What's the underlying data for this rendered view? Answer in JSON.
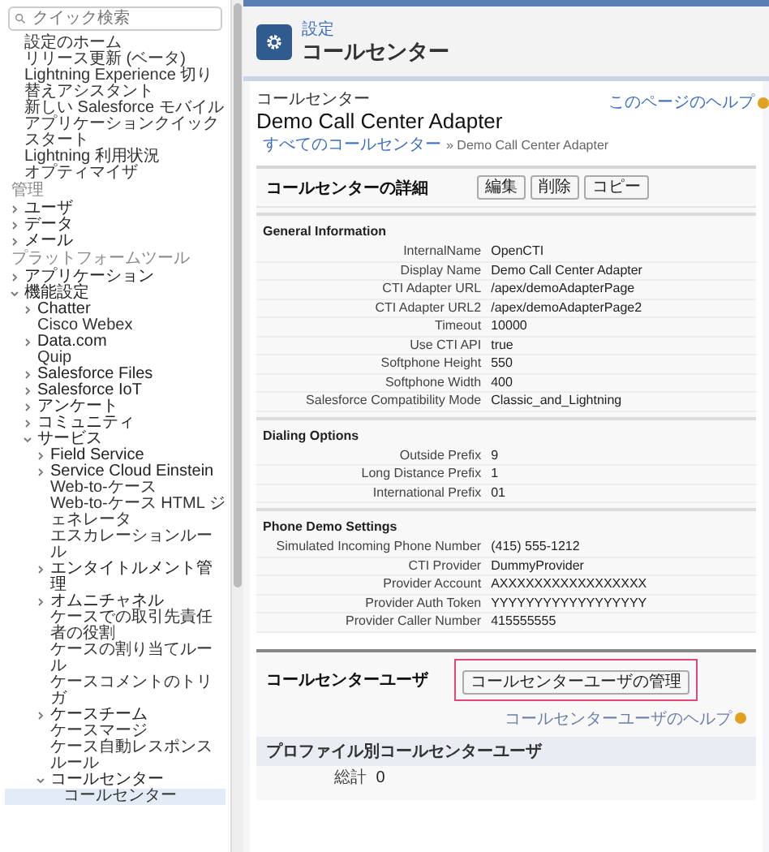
{
  "sidebar": {
    "search": {
      "placeholder": "クイック検索"
    },
    "items": [
      {
        "label": "設定のホーム",
        "kind": "link",
        "selected": false
      },
      {
        "label": "リリース更新 (ベータ)",
        "kind": "link",
        "selected": false
      },
      {
        "label": "Lightning Experience 切り替えアシスタント",
        "kind": "link",
        "selected": false
      },
      {
        "label": "新しい Salesforce モバイルアプリケーションクイックスタート",
        "kind": "link",
        "selected": false
      },
      {
        "label": "Lightning 利用状況",
        "kind": "link",
        "selected": false
      },
      {
        "label": "オプティマイザ",
        "kind": "link",
        "selected": false
      },
      {
        "label": "管理",
        "kind": "heading"
      },
      {
        "label": "ユーザ",
        "kind": "node",
        "expanded": false,
        "selected": false
      },
      {
        "label": "データ",
        "kind": "node",
        "expanded": false,
        "selected": false
      },
      {
        "label": "メール",
        "kind": "node",
        "expanded": false,
        "selected": false
      },
      {
        "label": "プラットフォームツール",
        "kind": "heading"
      },
      {
        "label": "アプリケーション",
        "kind": "node",
        "expanded": false,
        "selected": false
      },
      {
        "label": "機能設定",
        "kind": "node",
        "expanded": true,
        "selected": false,
        "children": [
          {
            "label": "Chatter",
            "kind": "node",
            "expanded": false,
            "selected": false
          },
          {
            "label": "Cisco Webex",
            "kind": "link",
            "selected": false
          },
          {
            "label": "Data.com",
            "kind": "node",
            "expanded": false,
            "selected": false
          },
          {
            "label": "Quip",
            "kind": "link",
            "selected": false
          },
          {
            "label": "Salesforce Files",
            "kind": "node",
            "expanded": false,
            "selected": false
          },
          {
            "label": "Salesforce IoT",
            "kind": "node",
            "expanded": false,
            "selected": false
          },
          {
            "label": "アンケート",
            "kind": "node",
            "expanded": false,
            "selected": false
          },
          {
            "label": "コミュニティ",
            "kind": "node",
            "expanded": false,
            "selected": false
          },
          {
            "label": "サービス",
            "kind": "node",
            "expanded": true,
            "selected": false,
            "children": [
              {
                "label": "Field Service",
                "kind": "node",
                "expanded": false,
                "selected": false
              },
              {
                "label": "Service Cloud Einstein",
                "kind": "node",
                "expanded": false,
                "selected": false
              },
              {
                "label": "Web-to-ケース",
                "kind": "link",
                "selected": false
              },
              {
                "label": "Web-to-ケース HTML ジェネレータ",
                "kind": "link",
                "selected": false
              },
              {
                "label": "エスカレーションルール",
                "kind": "link",
                "selected": false
              },
              {
                "label": "エンタイトルメント管理",
                "kind": "node",
                "expanded": false,
                "selected": false
              },
              {
                "label": "オムニチャネル",
                "kind": "node",
                "expanded": false,
                "selected": false
              },
              {
                "label": "ケースでの取引先責任者の役割",
                "kind": "link",
                "selected": false
              },
              {
                "label": "ケースの割り当てルール",
                "kind": "link",
                "selected": false
              },
              {
                "label": "ケースコメントのトリガ",
                "kind": "link",
                "selected": false
              },
              {
                "label": "ケースチーム",
                "kind": "node",
                "expanded": false,
                "selected": false
              },
              {
                "label": "ケースマージ",
                "kind": "link",
                "selected": false
              },
              {
                "label": "ケース自動レスポンスルール",
                "kind": "link",
                "selected": false
              },
              {
                "label": "コールセンター",
                "kind": "node",
                "expanded": true,
                "selected": false,
                "children": [
                  {
                    "label": "コールセンター",
                    "kind": "link",
                    "selected": true
                  }
                ]
              }
            ]
          }
        ]
      }
    ]
  },
  "header": {
    "breadcrumb": "設定",
    "title": "コールセンター"
  },
  "record": {
    "type_label": "コールセンター",
    "title": "Demo Call Center Adapter",
    "breadcrumb_link": "すべてのコールセンター",
    "breadcrumb_rest": "» Demo Call Center Adapter",
    "help_link": "このページのヘルプ"
  },
  "detail": {
    "title": "コールセンターの詳細",
    "buttons": [
      "編集",
      "削除",
      "コピー"
    ],
    "sections": [
      {
        "title": "General Information",
        "rows": [
          {
            "label": "InternalName",
            "value": "OpenCTI"
          },
          {
            "label": "Display Name",
            "value": "Demo Call Center Adapter"
          },
          {
            "label": "CTI Adapter URL",
            "value": "/apex/demoAdapterPage"
          },
          {
            "label": "CTI Adapter URL2",
            "value": "/apex/demoAdapterPage2"
          },
          {
            "label": "Timeout",
            "value": "10000"
          },
          {
            "label": "Use CTI API",
            "value": "true"
          },
          {
            "label": "Softphone Height",
            "value": "550"
          },
          {
            "label": "Softphone Width",
            "value": "400"
          },
          {
            "label": "Salesforce Compatibility Mode",
            "value": "Classic_and_Lightning"
          }
        ]
      },
      {
        "title": "Dialing Options",
        "rows": [
          {
            "label": "Outside Prefix",
            "value": "9"
          },
          {
            "label": "Long Distance Prefix",
            "value": "1"
          },
          {
            "label": "International Prefix",
            "value": "01"
          }
        ]
      },
      {
        "title": "Phone Demo Settings",
        "rows": [
          {
            "label": "Simulated Incoming Phone Number",
            "value": "(415) 555-1212"
          },
          {
            "label": "CTI Provider",
            "value": "DummyProvider"
          },
          {
            "label": "Provider Account",
            "value": "AXXXXXXXXXXXXXXXXX"
          },
          {
            "label": "Provider Auth Token",
            "value": "YYYYYYYYYYYYYYYYYY"
          },
          {
            "label": "Provider Caller Number",
            "value": "415555555"
          }
        ]
      }
    ]
  },
  "related": {
    "title": "コールセンターユーザ",
    "button": "コールセンターユーザの管理",
    "highlighted": true,
    "help_link": "コールセンターユーザのヘルプ",
    "subheading": "プロファイル別コールセンターユーザ",
    "rows": [
      {
        "label": "総計",
        "value": "0"
      }
    ]
  }
}
